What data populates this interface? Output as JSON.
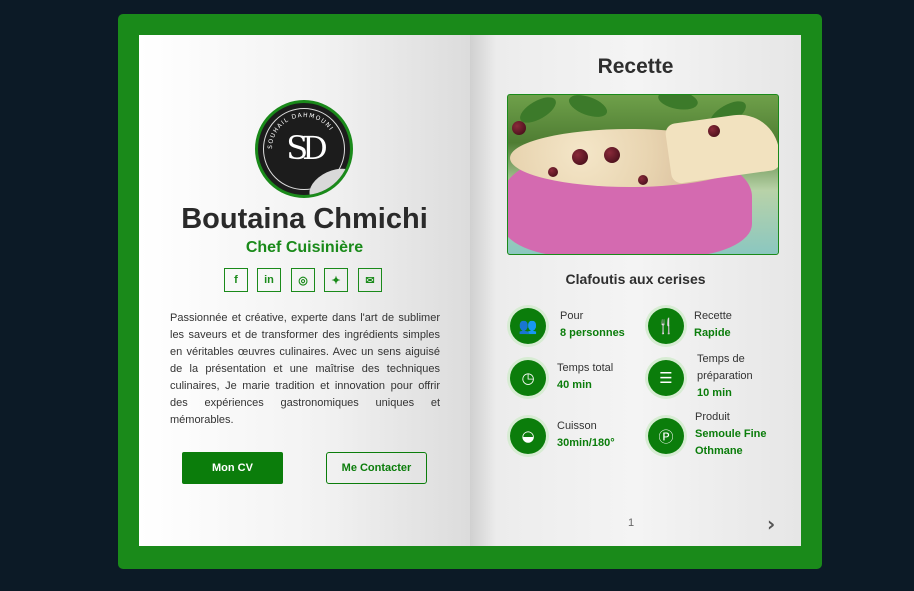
{
  "profile": {
    "logo_initials": "SD",
    "logo_ring_text": "SOUHAIL DAHMOUNI",
    "name": "Boutaina Chmichi",
    "title": "Chef Cuisinière",
    "bio": "Passionnée et créative, experte dans l'art de sublimer les saveurs et de transformer des ingrédients simples en véritables œuvres culinaires. Avec un sens aiguisé de la présentation et une maîtrise des techniques culinaires, Je marie tradition et innovation pour offrir des expériences gastronomiques uniques et mémorables.",
    "socials": [
      {
        "icon": "facebook-icon",
        "glyph": "f"
      },
      {
        "icon": "linkedin-icon",
        "glyph": "in"
      },
      {
        "icon": "instagram-icon",
        "glyph": "◎"
      },
      {
        "icon": "twitter-icon",
        "glyph": "✦"
      },
      {
        "icon": "email-icon",
        "glyph": "✉"
      }
    ],
    "cv_label": "Mon CV",
    "contact_label": "Me Contacter"
  },
  "recipe": {
    "heading": "Recette",
    "name": "Clafoutis aux cerises",
    "stats": [
      {
        "icon": "people-icon",
        "glyph": "👥",
        "label": "Pour",
        "value": "8 personnes"
      },
      {
        "icon": "utensils-icon",
        "glyph": "🍴",
        "label": "Recette",
        "value": "Rapide"
      },
      {
        "icon": "clock-icon",
        "glyph": "◷",
        "label": "Temps total",
        "value": "40 min"
      },
      {
        "icon": "prep-icon",
        "glyph": "☰",
        "label": "Temps de préparation",
        "label_line1": "Temps de",
        "label_line2": "préparation",
        "value": "10 min"
      },
      {
        "icon": "bowl-icon",
        "glyph": "◒",
        "label": "Cuisson",
        "value": "30min/180°"
      },
      {
        "icon": "product-icon",
        "glyph": "Ⓟ",
        "label": "Produit",
        "value_line1": "Semoule Fine",
        "value_line2": "Othmane"
      }
    ]
  },
  "pagination": {
    "page_number": "1",
    "next_glyph": "›"
  },
  "colors": {
    "accent": "#0b7d0b",
    "frame": "#1a8a1a",
    "background": "#0c1a26"
  }
}
